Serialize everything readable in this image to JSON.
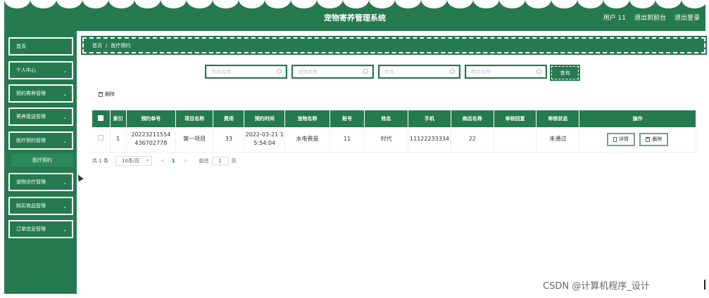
{
  "header": {
    "title": "宠物寄养管理系统",
    "user": "用户 11",
    "back_to_admin": "退出到前台",
    "logout": "退出登录"
  },
  "sidebar": {
    "items": [
      {
        "label": "首页"
      },
      {
        "label": "个人中心"
      },
      {
        "label": "预约寄养管理"
      },
      {
        "label": "寄养接送管理"
      },
      {
        "label": "医疗预约管理"
      },
      {
        "label": "宠物诊疗管理"
      },
      {
        "label": "购买商品管理"
      },
      {
        "label": "订单信息管理"
      }
    ],
    "active_sub": "医疗预约"
  },
  "breadcrumb": {
    "home": "首页",
    "separator": "/",
    "current": "医疗预约"
  },
  "search": {
    "project_placeholder": "项目名称",
    "pet_placeholder": "宠物名称",
    "name_placeholder": "姓名",
    "shop_placeholder": "商店名称",
    "query_label": "查询"
  },
  "toolbar": {
    "delete_label": "删除"
  },
  "table": {
    "headers": [
      "索引",
      "预约单号",
      "项目名称",
      "费用",
      "预约时间",
      "宠物名称",
      "账号",
      "姓名",
      "手机",
      "商店名称",
      "审核回复",
      "审核状态",
      "操作"
    ],
    "rows": [
      {
        "index": "1",
        "order_no": "20223211554 436702778",
        "project": "第一项目",
        "fee": "33",
        "time": "2022-03-21 1 5:54:04",
        "pet": "水电费是",
        "account": "11",
        "name": "时代",
        "phone": "11122233334",
        "shop": "22",
        "reply": "",
        "status": "未通过",
        "detail_label": "详情",
        "delete_label": "删除"
      }
    ]
  },
  "pagination": {
    "total": "共 1 条",
    "page_size": "10条/页",
    "prev": "<",
    "current": "1",
    "next": ">",
    "goto_label": "前往",
    "goto_value": "1",
    "page_unit": "页"
  },
  "watermark": "CSDN @计算机程序_设计",
  "colors": {
    "primary": "#257a4f"
  }
}
